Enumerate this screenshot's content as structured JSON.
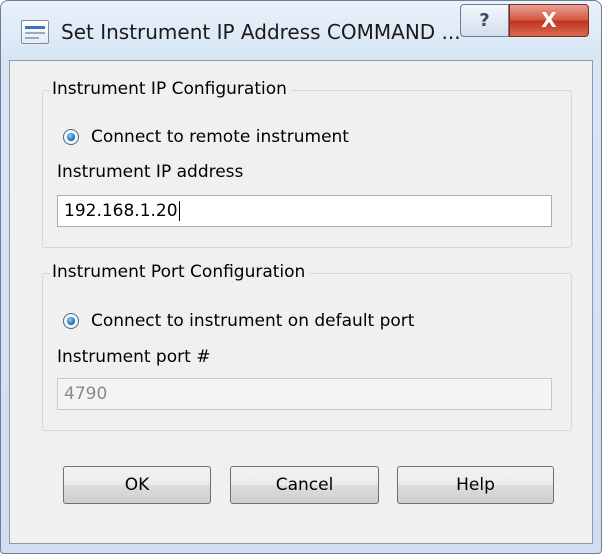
{
  "window": {
    "title": "Set Instrument IP Address COMMAND ...",
    "help_button": "?",
    "close_button": "X"
  },
  "ip_group": {
    "legend": "Instrument IP Configuration",
    "radio_label": "Connect to remote instrument",
    "radio_selected": true,
    "field_label": "Instrument IP address",
    "field_value": "192.168.1.20"
  },
  "port_group": {
    "legend": "Instrument Port Configuration",
    "radio_label": "Connect to instrument on default port",
    "radio_selected": true,
    "field_label": "Instrument port #",
    "field_value": "4790"
  },
  "buttons": {
    "ok": "OK",
    "cancel": "Cancel",
    "help": "Help"
  }
}
